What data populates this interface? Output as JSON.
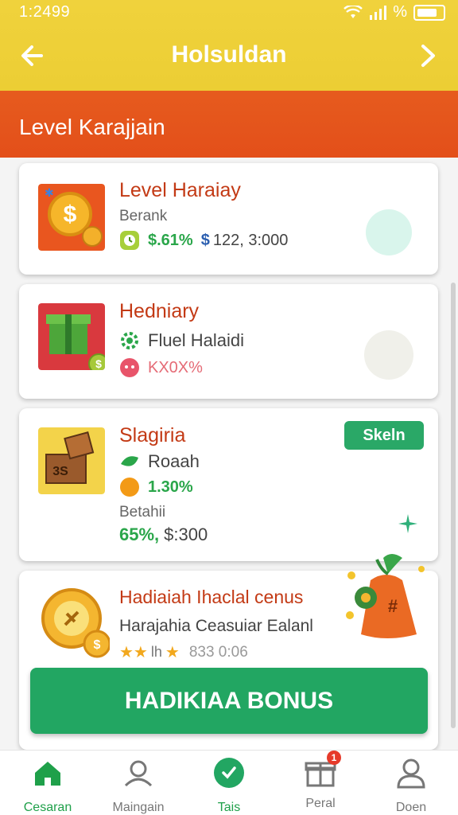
{
  "status": {
    "time": "1:2499",
    "signal_text": "%"
  },
  "header": {
    "title": "Holsuldan"
  },
  "banner": {
    "title": "Level Karajjain"
  },
  "cards": [
    {
      "title": "Level Haraiay",
      "subtitle": "Berank",
      "stat_pct": "$.61%",
      "stat_value": "$",
      "stat_amount": "122, 3:000"
    },
    {
      "title": "Hedniary",
      "line1": "Fluel Halaidi",
      "line2": "KX0X%"
    },
    {
      "title": "Slagiria",
      "badge": "Skeln",
      "line1": "Roaah",
      "line2": "1.30%",
      "subtitle": "Betahii",
      "bottom_pct": "65%,",
      "bottom_amount": "$:300"
    },
    {
      "title": "Hadiaiah Ihaclal cenus",
      "line1": "Harajahia Ceasuiar Ealanl",
      "rating": "★★",
      "rating_text": "lh",
      "rating_star": "★",
      "rating_value": "833 0:06"
    }
  ],
  "bonus_button": {
    "label": "HADIKIAA BONUS"
  },
  "tabs": [
    {
      "label": "Cesaran",
      "icon": "home-icon"
    },
    {
      "label": "Maingain",
      "icon": "user-search-icon"
    },
    {
      "label": "Tais",
      "icon": "check-circle-icon"
    },
    {
      "label": "Peral",
      "icon": "gift-box-icon",
      "badge": "1"
    },
    {
      "label": "Doen",
      "icon": "profile-icon"
    }
  ],
  "colors": {
    "header": "#ecce34",
    "banner": "#e34f1a",
    "accent_green": "#22a662",
    "title_red": "#c33a15"
  }
}
